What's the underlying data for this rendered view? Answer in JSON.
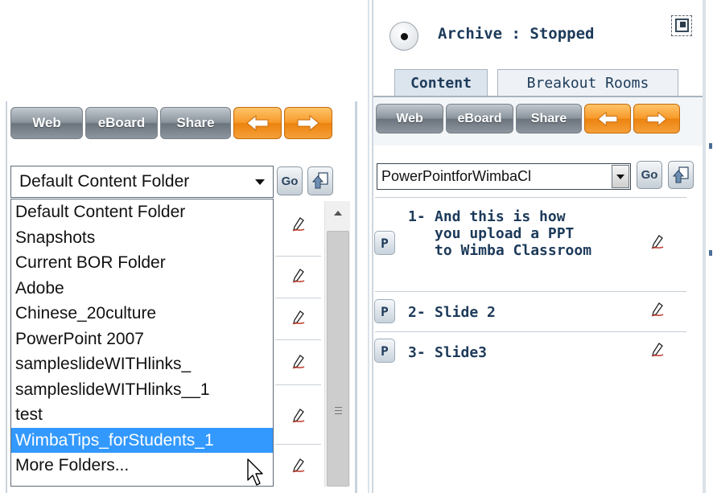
{
  "left": {
    "toolbar": {
      "web": "Web",
      "eboard": "eBoard",
      "share": "Share",
      "back_icon": "arrow-left-icon",
      "forward_icon": "arrow-right-icon"
    },
    "folder_select": {
      "value": "Default Content Folder"
    },
    "go_label": "Go",
    "folder_options": [
      "Default Content Folder",
      "Snapshots",
      "Current BOR Folder",
      "Adobe",
      "Chinese_20culture",
      "PowerPoint 2007",
      "sampleslideWITHlinks_",
      "sampleslideWITHlinks__1",
      "test",
      "WimbaTips_forStudents_1",
      "More Folders..."
    ],
    "selected_option": "WimbaTips_forStudents_1"
  },
  "right": {
    "archive_status": "Archive : Stopped",
    "tabs": [
      {
        "label": "Content",
        "active": true
      },
      {
        "label": "Breakout Rooms",
        "active": false
      }
    ],
    "toolbar": {
      "web": "Web",
      "eboard": "eBoard",
      "share": "Share"
    },
    "presentation_select": {
      "value": "PowerPointforWimbaCl"
    },
    "go_label": "Go",
    "slides": [
      {
        "p": "P",
        "number": "1-",
        "title": "And this is how you upload a PPT to Wimba Classroom"
      },
      {
        "p": "P",
        "number": "2-",
        "title": "Slide 2"
      },
      {
        "p": "P",
        "number": "3-",
        "title": "Slide3"
      }
    ]
  },
  "colors": {
    "selection": "#3399ff",
    "orange_button": "#f79a2a",
    "gray_button": "#8a939c",
    "text_navy": "#1d3a5a"
  }
}
